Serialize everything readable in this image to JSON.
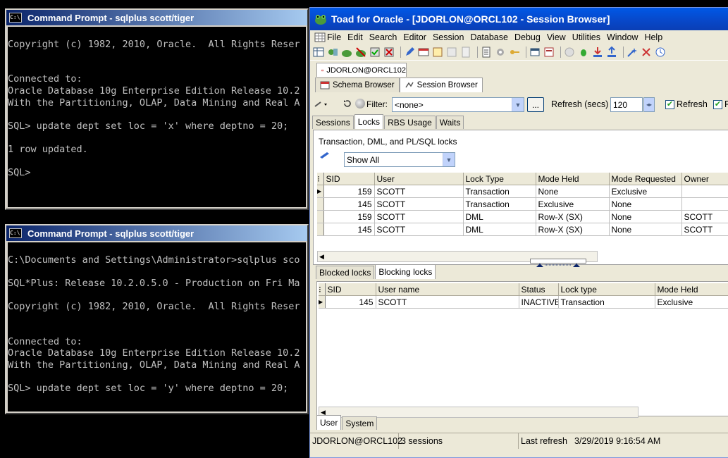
{
  "cmd1": {
    "title": "Command Prompt - sqlplus scott/tiger",
    "lines": [
      "",
      "Copyright (c) 1982, 2010, Oracle.  All Rights Reser",
      "",
      "",
      "Connected to:",
      "Oracle Database 10g Enterprise Edition Release 10.2",
      "With the Partitioning, OLAP, Data Mining and Real A",
      "",
      "SQL> update dept set loc = 'x' where deptno = 20;",
      "",
      "1 row updated.",
      "",
      "SQL>"
    ]
  },
  "cmd2": {
    "title": "Command Prompt - sqlplus scott/tiger",
    "lines": [
      "",
      "C:\\Documents and Settings\\Administrator>sqlplus sco",
      "",
      "SQL*Plus: Release 10.2.0.5.0 - Production on Fri Ma",
      "",
      "Copyright (c) 1982, 2010, Oracle.  All Rights Reser",
      "",
      "",
      "Connected to:",
      "Oracle Database 10g Enterprise Edition Release 10.2",
      "With the Partitioning, OLAP, Data Mining and Real A",
      "",
      "SQL> update dept set loc = 'y' where deptno = 20;"
    ]
  },
  "toad": {
    "title": "Toad for Oracle - [JDORLON@ORCL102 - Session Browser]",
    "menu": [
      "File",
      "Edit",
      "Search",
      "Editor",
      "Session",
      "Database",
      "Debug",
      "View",
      "Utilities",
      "Window",
      "Help"
    ],
    "connection_tab": "JDORLON@ORCL102",
    "window_tabs": [
      "Schema Browser",
      "Session Browser"
    ],
    "filter_label": "Filter:",
    "filter_value": "<none>",
    "ellipsis": "...",
    "refresh_label": "Refresh (secs)",
    "refresh_value": "120",
    "refresh_checkbox": "Refresh",
    "fe_checkbox": "Fe",
    "sub_tabs": [
      "Sessions",
      "Locks",
      "RBS Usage",
      "Waits"
    ],
    "locks_heading": "Transaction, DML, and PL/SQL locks",
    "show_all": "Show All",
    "locks_columns": [
      "SID",
      "User",
      "Lock Type",
      "Mode Held",
      "Mode Requested",
      "Owner"
    ],
    "locks_rows": [
      [
        "159",
        "SCOTT",
        "Transaction",
        "None",
        "Exclusive",
        ""
      ],
      [
        "145",
        "SCOTT",
        "Transaction",
        "Exclusive",
        "None",
        ""
      ],
      [
        "159",
        "SCOTT",
        "DML",
        "Row-X (SX)",
        "None",
        "SCOTT"
      ],
      [
        "145",
        "SCOTT",
        "DML",
        "Row-X (SX)",
        "None",
        "SCOTT"
      ]
    ],
    "lower_tabs": [
      "Blocked locks",
      "Blocking locks"
    ],
    "blocking_columns": [
      "SID",
      "User name",
      "Status",
      "Lock type",
      "Mode Held"
    ],
    "blocking_rows": [
      [
        "145",
        "SCOTT",
        "INACTIVE",
        "Transaction",
        "Exclusive"
      ]
    ],
    "bottom_tabs": [
      "User",
      "System"
    ],
    "status": {
      "connection": "JDORLON@ORCL102",
      "sessions": "3 sessions",
      "last_refresh_label": "Last refresh",
      "last_refresh_value": "3/29/2019 9:16:54 AM"
    }
  }
}
